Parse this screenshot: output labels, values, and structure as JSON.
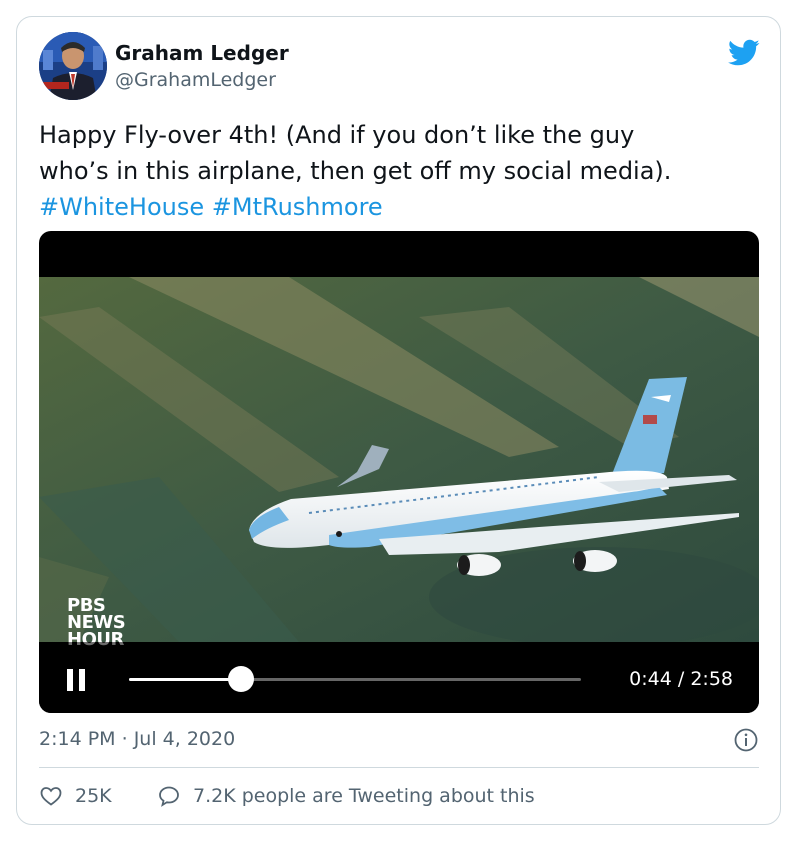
{
  "author": {
    "name": "Graham Ledger",
    "handle": "@GrahamLedger"
  },
  "tweet": {
    "text_line1": "Happy Fly-over 4th! (And if you don’t like the guy",
    "text_line2": "who’s in this airplane, then get off my social media).",
    "hashtags": [
      "#WhiteHouse",
      "#MtRushmore"
    ]
  },
  "video": {
    "watermark_line1": "PBS",
    "watermark_line2": "NEWS",
    "watermark_line3": "HOUR",
    "current_time": "0:44",
    "duration": "2:58",
    "progress": 0.247
  },
  "meta": {
    "time": "2:14 PM",
    "separator": "·",
    "date": "Jul 4, 2020"
  },
  "actions": {
    "likes": "25K",
    "conversation": "7.2K people are Tweeting about this"
  },
  "colors": {
    "accent": "#1b95e0",
    "twitter_blue": "#1da1f2",
    "text_secondary": "#536471",
    "border": "#cfd9de"
  },
  "icons": {
    "brand": "twitter-bird-icon",
    "pause": "pause-icon",
    "info": "info-icon",
    "like": "heart-icon",
    "reply": "speech-bubble-icon"
  }
}
